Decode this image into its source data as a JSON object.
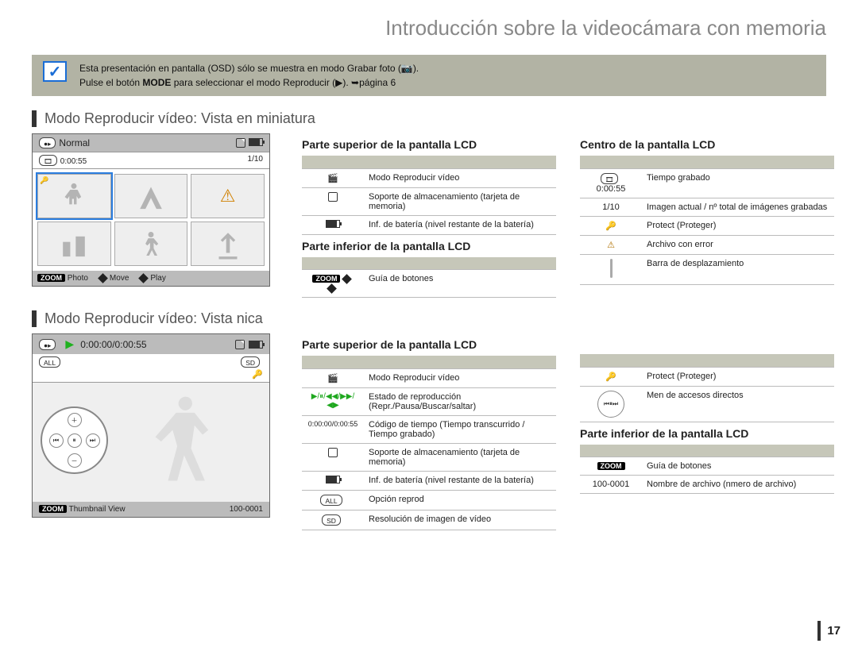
{
  "page_title": "Introducción sobre la videocámara con memoria",
  "page_number": "17",
  "note": {
    "line1": "Esta presentación en pantalla (OSD) sólo se muestra en modo Grabar foto (📷).",
    "line2_pre": "Pulse el botón ",
    "mode_label": "MODE",
    "line2_mid": " para seleccionar el modo Reproducir (▶). ➥página",
    "page_ref": "6"
  },
  "section1": {
    "title": "Modo Reproducir vídeo: Vista en miniatura",
    "lcd": {
      "mode": "Normal",
      "clip_time": "0:00:55",
      "counter": "1/10",
      "bottom": {
        "zoom": "ZOOM",
        "photo": "Photo",
        "move": "Move",
        "play": "Play"
      }
    },
    "top_title": "Parte superior de la pantalla LCD",
    "top_rows": [
      {
        "ic": "🎬",
        "txt": "Modo Reproducir vídeo"
      },
      {
        "ic": "💾",
        "txt": "Soporte de almacenamiento (tarjeta de memoria)"
      },
      {
        "ic": "🔋",
        "txt": "Inf. de batería (nivel restante de la batería)"
      }
    ],
    "bottom_title": "Parte inferior de la pantalla LCD",
    "bottom_rows": [
      {
        "ic": "ZOOM ◆ ◆",
        "txt": "Guía de botones"
      }
    ],
    "center_title": "Centro de la pantalla LCD",
    "center_rows": [
      {
        "ic": "0:00:55",
        "txt": "Tiempo grabado"
      },
      {
        "ic": "1/10",
        "txt": "Imagen actual / nº total de imágenes grabadas"
      },
      {
        "ic": "🔑",
        "txt": "Protect (Proteger)"
      },
      {
        "ic": "⚠",
        "txt": "Archivo con error"
      },
      {
        "ic": "|",
        "txt": "Barra de desplazamiento"
      }
    ]
  },
  "section2": {
    "title": "Modo Reproducir vídeo: Vista nica",
    "lcd": {
      "timecode": "0:00:00/0:00:55",
      "sd_label": "SD",
      "footer_label": "Thumbnail View",
      "footer_zoom": "ZOOM",
      "filename": "100-0001"
    },
    "top_title": "Parte superior de la pantalla LCD",
    "top_rows": [
      {
        "ic": "🎬",
        "txt": "Modo Reproducir vídeo"
      },
      {
        "ic": "▶/⏸/◀◀/▶▶/◀▶",
        "txt": "Estado de reproducción (Repr./Pausa/Buscar/saltar)"
      },
      {
        "ic": "0:00:00/0:00:55",
        "txt": "Código de tiempo (Tiempo transcurrido / Tiempo grabado)"
      },
      {
        "ic": "💾",
        "txt": "Soporte de almacenamiento (tarjeta de memoria)"
      },
      {
        "ic": "🔋",
        "txt": "Inf. de batería (nivel restante de la batería)"
      },
      {
        "ic": "ALL",
        "txt": "Opción reprod"
      },
      {
        "ic": "SD",
        "txt": "Resolución de imagen de vídeo"
      }
    ],
    "right_rows": [
      {
        "ic": "🔑",
        "txt": "Protect (Proteger)"
      },
      {
        "ic": "⊕◀⏸▶⊖",
        "txt": "Men de accesos directos"
      }
    ],
    "bottom_title": "Parte inferior de la pantalla LCD",
    "bottom_rows": [
      {
        "ic": "ZOOM",
        "txt": "Guía de botones"
      },
      {
        "ic": "100-0001",
        "txt": "Nombre de archivo (nmero de archivo)"
      }
    ]
  }
}
